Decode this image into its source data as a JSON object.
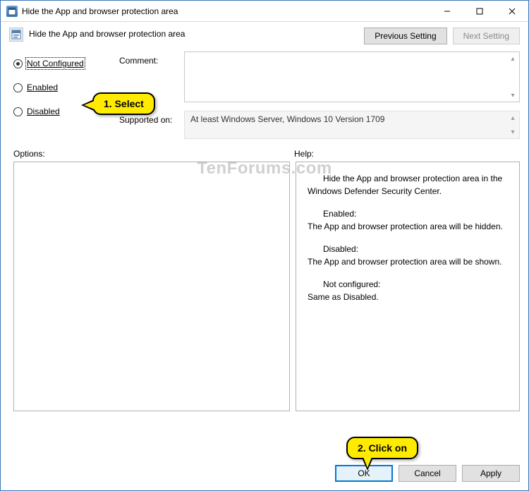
{
  "window": {
    "title": "Hide the App and browser protection area"
  },
  "header": {
    "title": "Hide the App and browser protection area",
    "buttons": {
      "previous": "Previous Setting",
      "next": "Next Setting"
    }
  },
  "radios": {
    "not_configured": "Not Configured",
    "enabled": "Enabled",
    "disabled": "Disabled",
    "selected": "not_configured"
  },
  "fields": {
    "comment_label": "Comment:",
    "comment_value": "",
    "supported_label": "Supported on:",
    "supported_value": "At least Windows Server, Windows 10 Version 1709"
  },
  "sections": {
    "options_label": "Options:",
    "help_label": "Help:"
  },
  "help": {
    "p1": "Hide the App and browser protection area in the Windows Defender Security Center.",
    "p2a": "Enabled:",
    "p2b": "The App and browser protection area will be hidden.",
    "p3a": "Disabled:",
    "p3b": "The App and browser protection area will be shown.",
    "p4a": "Not configured:",
    "p4b": "Same as Disabled."
  },
  "footer": {
    "ok": "OK",
    "cancel": "Cancel",
    "apply": "Apply"
  },
  "annotations": {
    "select": "1. Select",
    "click_on": "2. Click on"
  },
  "watermark": "TenForums.com"
}
